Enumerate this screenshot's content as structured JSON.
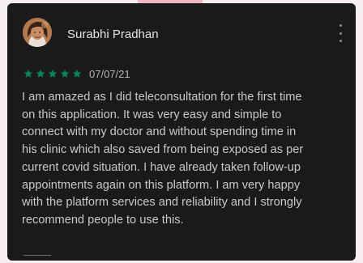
{
  "review": {
    "reviewer_name": "Surabhi Pradhan",
    "rating": 5,
    "max_rating": 5,
    "star_color": "#01875f",
    "date": "07/07/21",
    "text_lines": [
      "I am amazed as I did teleconsultation for the first time",
      "on this application. It was very easy and simple to",
      "connect with my doctor and without spending time in",
      "his clinic which also saved from being exposed as per",
      "current covid situation. I have already taken follow-up",
      "appointments again on this platform. I am very happy",
      "with the platform services and reliability and I strongly",
      "recommend people to use this."
    ]
  },
  "icons": {
    "avatar": "avatar",
    "more": "more-options-icon",
    "star": "star-icon"
  },
  "colors": {
    "card_background": "#1a1a1b",
    "page_background": "#f6eef0",
    "text": "#c9c9c9"
  }
}
